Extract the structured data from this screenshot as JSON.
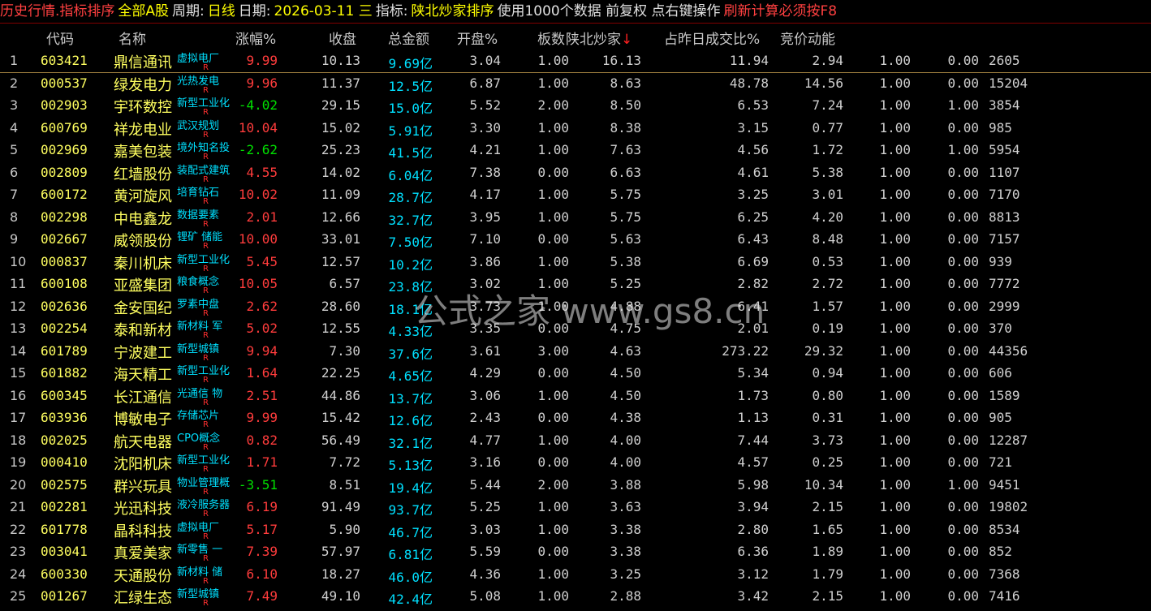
{
  "topbar": {
    "segments": [
      {
        "text": "历史行情.指标排序",
        "color": "red"
      },
      {
        "text": "全部A股",
        "color": "yellow"
      },
      {
        "text": "周期:",
        "color": "white"
      },
      {
        "text": "日线",
        "color": "yellow"
      },
      {
        "text": "日期:",
        "color": "white"
      },
      {
        "text": "2026-03-11 三",
        "color": "yellow"
      },
      {
        "text": "指标:",
        "color": "white"
      },
      {
        "text": "陕北炒家排序",
        "color": "yellow"
      },
      {
        "text": "使用1000个数据 前复权 点右键操作",
        "color": "white"
      },
      {
        "text": "刷新计算必须按F8",
        "color": "red"
      }
    ]
  },
  "columns": [
    "代码",
    "名称",
    "涨幅%",
    "收盘",
    "总金额",
    "开盘%",
    "板数",
    "陕北炒家",
    "占昨日成交比%",
    "竞价动能"
  ],
  "sort_indicator": "↓",
  "watermark": "公式之家 www.gs8.cn",
  "rows": [
    {
      "i": "1",
      "code": "603421",
      "name": "鼎信通讯",
      "tag": "虚拟电厂",
      "chg": "9.99",
      "close": "10.13",
      "amt": "9.69亿",
      "open": "3.04",
      "boards": "1.00",
      "sbcj": "16.13",
      "ratio": "11.94",
      "jj": "2.94",
      "c1": "1.00",
      "c2": "0.00",
      "c3": "2605"
    },
    {
      "i": "2",
      "code": "000537",
      "name": "绿发电力",
      "tag": "光热发电",
      "chg": "9.96",
      "close": "11.37",
      "amt": "12.5亿",
      "open": "6.87",
      "boards": "1.00",
      "sbcj": "8.63",
      "ratio": "48.78",
      "jj": "14.56",
      "c1": "1.00",
      "c2": "0.00",
      "c3": "15204"
    },
    {
      "i": "3",
      "code": "002903",
      "name": "宇环数控",
      "tag": "新型工业化",
      "chg": "-4.02",
      "close": "29.15",
      "amt": "15.0亿",
      "open": "5.52",
      "boards": "2.00",
      "sbcj": "8.50",
      "ratio": "6.53",
      "jj": "7.24",
      "c1": "1.00",
      "c2": "1.00",
      "c3": "3854"
    },
    {
      "i": "4",
      "code": "600769",
      "name": "祥龙电业",
      "tag": "武汉规划",
      "chg": "10.04",
      "close": "15.02",
      "amt": "5.91亿",
      "open": "3.30",
      "boards": "1.00",
      "sbcj": "8.38",
      "ratio": "3.15",
      "jj": "0.77",
      "c1": "1.00",
      "c2": "0.00",
      "c3": "985"
    },
    {
      "i": "5",
      "code": "002969",
      "name": "嘉美包装",
      "tag": "境外知名投",
      "chg": "-2.62",
      "close": "25.23",
      "amt": "41.5亿",
      "open": "4.21",
      "boards": "1.00",
      "sbcj": "7.63",
      "ratio": "4.56",
      "jj": "1.72",
      "c1": "1.00",
      "c2": "1.00",
      "c3": "5954"
    },
    {
      "i": "6",
      "code": "002809",
      "name": "红墙股份",
      "tag": "装配式建筑",
      "chg": "4.55",
      "close": "14.02",
      "amt": "6.04亿",
      "open": "7.38",
      "boards": "0.00",
      "sbcj": "6.63",
      "ratio": "4.61",
      "jj": "5.38",
      "c1": "1.00",
      "c2": "0.00",
      "c3": "1107"
    },
    {
      "i": "7",
      "code": "600172",
      "name": "黄河旋风",
      "tag": "培育钻石",
      "chg": "10.02",
      "close": "11.09",
      "amt": "28.7亿",
      "open": "4.17",
      "boards": "1.00",
      "sbcj": "5.75",
      "ratio": "3.25",
      "jj": "3.01",
      "c1": "1.00",
      "c2": "0.00",
      "c3": "7170"
    },
    {
      "i": "8",
      "code": "002298",
      "name": "中电鑫龙",
      "tag": "数据要素",
      "chg": "2.01",
      "close": "12.66",
      "amt": "32.7亿",
      "open": "3.95",
      "boards": "1.00",
      "sbcj": "5.75",
      "ratio": "6.25",
      "jj": "4.20",
      "c1": "1.00",
      "c2": "0.00",
      "c3": "8813"
    },
    {
      "i": "9",
      "code": "002667",
      "name": "威领股份",
      "tag": "锂矿 储能",
      "chg": "10.00",
      "close": "33.01",
      "amt": "7.50亿",
      "open": "7.10",
      "boards": "0.00",
      "sbcj": "5.63",
      "ratio": "6.43",
      "jj": "8.48",
      "c1": "1.00",
      "c2": "0.00",
      "c3": "7157"
    },
    {
      "i": "10",
      "code": "000837",
      "name": "秦川机床",
      "tag": "新型工业化",
      "chg": "5.45",
      "close": "12.57",
      "amt": "10.2亿",
      "open": "3.86",
      "boards": "1.00",
      "sbcj": "5.38",
      "ratio": "6.69",
      "jj": "0.53",
      "c1": "1.00",
      "c2": "0.00",
      "c3": "939"
    },
    {
      "i": "11",
      "code": "600108",
      "name": "亚盛集团",
      "tag": "粮食概念",
      "chg": "10.05",
      "close": "6.57",
      "amt": "23.8亿",
      "open": "3.02",
      "boards": "1.00",
      "sbcj": "5.25",
      "ratio": "2.82",
      "jj": "2.72",
      "c1": "1.00",
      "c2": "0.00",
      "c3": "7772"
    },
    {
      "i": "12",
      "code": "002636",
      "name": "金安国纪",
      "tag": "罗素中盘",
      "chg": "2.62",
      "close": "28.60",
      "amt": "18.1亿",
      "open": "3.73",
      "boards": "1.00",
      "sbcj": "4.88",
      "ratio": "6.41",
      "jj": "1.57",
      "c1": "1.00",
      "c2": "0.00",
      "c3": "2999"
    },
    {
      "i": "13",
      "code": "002254",
      "name": "泰和新材",
      "tag": "新材料 军",
      "chg": "5.02",
      "close": "12.55",
      "amt": "4.33亿",
      "open": "3.35",
      "boards": "0.00",
      "sbcj": "4.75",
      "ratio": "2.01",
      "jj": "0.19",
      "c1": "1.00",
      "c2": "0.00",
      "c3": "370"
    },
    {
      "i": "14",
      "code": "601789",
      "name": "宁波建工",
      "tag": "新型城镇",
      "chg": "9.94",
      "close": "7.30",
      "amt": "37.6亿",
      "open": "3.61",
      "boards": "3.00",
      "sbcj": "4.63",
      "ratio": "273.22",
      "jj": "29.32",
      "c1": "1.00",
      "c2": "0.00",
      "c3": "44356"
    },
    {
      "i": "15",
      "code": "601882",
      "name": "海天精工",
      "tag": "新型工业化",
      "chg": "1.64",
      "close": "22.25",
      "amt": "4.65亿",
      "open": "4.29",
      "boards": "0.00",
      "sbcj": "4.50",
      "ratio": "5.34",
      "jj": "0.94",
      "c1": "1.00",
      "c2": "0.00",
      "c3": "606"
    },
    {
      "i": "16",
      "code": "600345",
      "name": "长江通信",
      "tag": "光通信 物",
      "chg": "2.51",
      "close": "44.86",
      "amt": "13.7亿",
      "open": "3.06",
      "boards": "1.00",
      "sbcj": "4.50",
      "ratio": "1.73",
      "jj": "0.80",
      "c1": "1.00",
      "c2": "0.00",
      "c3": "1589"
    },
    {
      "i": "17",
      "code": "603936",
      "name": "博敏电子",
      "tag": "存储芯片",
      "chg": "9.99",
      "close": "15.42",
      "amt": "12.6亿",
      "open": "2.43",
      "boards": "0.00",
      "sbcj": "4.38",
      "ratio": "1.13",
      "jj": "0.31",
      "c1": "1.00",
      "c2": "0.00",
      "c3": "905"
    },
    {
      "i": "18",
      "code": "002025",
      "name": "航天电器",
      "tag": "CPO概念",
      "chg": "0.82",
      "close": "56.49",
      "amt": "32.1亿",
      "open": "4.77",
      "boards": "1.00",
      "sbcj": "4.00",
      "ratio": "7.44",
      "jj": "3.73",
      "c1": "1.00",
      "c2": "0.00",
      "c3": "12287"
    },
    {
      "i": "19",
      "code": "000410",
      "name": "沈阳机床",
      "tag": "新型工业化",
      "chg": "1.71",
      "close": "7.72",
      "amt": "5.13亿",
      "open": "3.16",
      "boards": "0.00",
      "sbcj": "4.00",
      "ratio": "4.57",
      "jj": "0.25",
      "c1": "1.00",
      "c2": "0.00",
      "c3": "721"
    },
    {
      "i": "20",
      "code": "002575",
      "name": "群兴玩具",
      "tag": "物业管理概",
      "chg": "-3.51",
      "close": "8.51",
      "amt": "19.4亿",
      "open": "5.44",
      "boards": "2.00",
      "sbcj": "3.88",
      "ratio": "5.98",
      "jj": "10.34",
      "c1": "1.00",
      "c2": "1.00",
      "c3": "9451"
    },
    {
      "i": "21",
      "code": "002281",
      "name": "光迅科技",
      "tag": "液冷服务器",
      "chg": "6.19",
      "close": "91.49",
      "amt": "93.7亿",
      "open": "5.25",
      "boards": "1.00",
      "sbcj": "3.63",
      "ratio": "3.94",
      "jj": "2.15",
      "c1": "1.00",
      "c2": "0.00",
      "c3": "19802"
    },
    {
      "i": "22",
      "code": "601778",
      "name": "晶科科技",
      "tag": "虚拟电厂",
      "chg": "5.17",
      "close": "5.90",
      "amt": "46.7亿",
      "open": "3.03",
      "boards": "1.00",
      "sbcj": "3.38",
      "ratio": "2.80",
      "jj": "1.65",
      "c1": "1.00",
      "c2": "0.00",
      "c3": "8534"
    },
    {
      "i": "23",
      "code": "003041",
      "name": "真爱美家",
      "tag": "新零售 一",
      "chg": "7.39",
      "close": "57.97",
      "amt": "6.81亿",
      "open": "5.59",
      "boards": "0.00",
      "sbcj": "3.38",
      "ratio": "6.36",
      "jj": "1.89",
      "c1": "1.00",
      "c2": "0.00",
      "c3": "852"
    },
    {
      "i": "24",
      "code": "600330",
      "name": "天通股份",
      "tag": "新材料 储",
      "chg": "6.10",
      "close": "18.27",
      "amt": "46.0亿",
      "open": "4.36",
      "boards": "1.00",
      "sbcj": "3.25",
      "ratio": "3.12",
      "jj": "1.79",
      "c1": "1.00",
      "c2": "0.00",
      "c3": "7368"
    },
    {
      "i": "25",
      "code": "001267",
      "name": "汇绿生态",
      "tag": "新型城镇",
      "chg": "7.49",
      "close": "49.10",
      "amt": "42.4亿",
      "open": "5.08",
      "boards": "1.00",
      "sbcj": "2.88",
      "ratio": "3.42",
      "jj": "2.15",
      "c1": "1.00",
      "c2": "0.00",
      "c3": "7416"
    }
  ]
}
